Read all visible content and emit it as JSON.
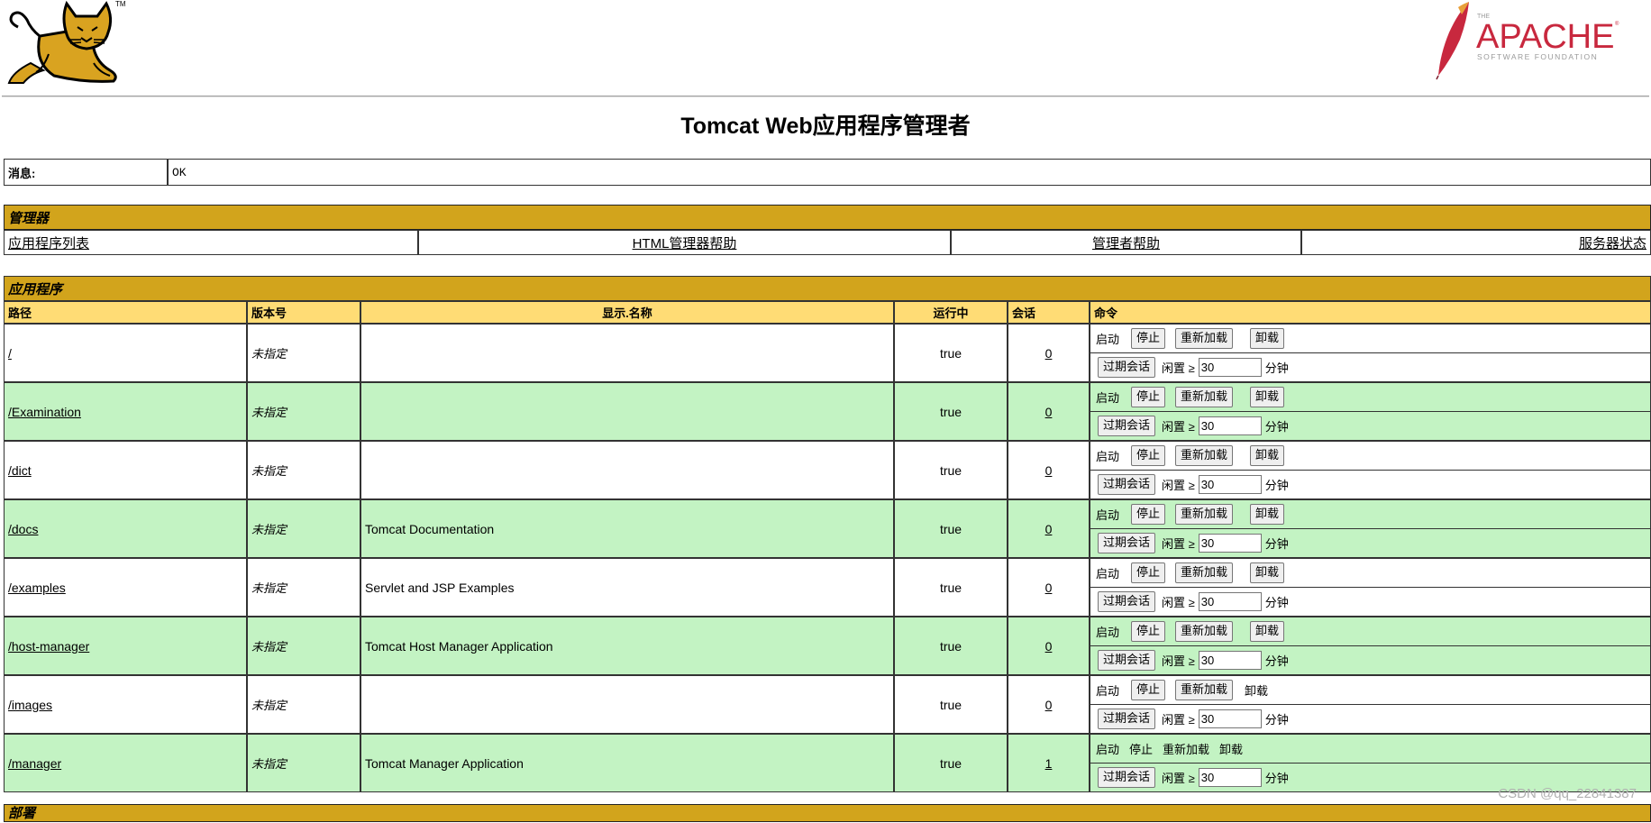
{
  "header": {
    "tomcat_tm": "TM",
    "apache_the": "THE",
    "apache_name": "APACHE",
    "apache_sub": "SOFTWARE FOUNDATION",
    "apache_reg": "®"
  },
  "page_title": "Tomcat Web应用程序管理者",
  "message": {
    "label": "消息:",
    "value": "OK"
  },
  "manager": {
    "title": "管理器",
    "links": [
      "应用程序列表",
      "HTML管理器帮助",
      "管理者帮助",
      "服务器状态"
    ]
  },
  "applications": {
    "title": "应用程序",
    "columns": [
      "路径",
      "版本号",
      "显示.名称",
      "运行中",
      "会话",
      "命令"
    ],
    "commands": {
      "start": "启动",
      "stop": "停止",
      "reload": "重新加载",
      "undeploy": "卸载",
      "expire": "过期会话",
      "idle": "闲置 ≥",
      "minutes": "分钟"
    },
    "rows": [
      {
        "path": "/",
        "version": "未指定",
        "display": "",
        "running": "true",
        "sessions": "0",
        "idle": "30"
      },
      {
        "path": "/Examination",
        "version": "未指定",
        "display": "",
        "running": "true",
        "sessions": "0",
        "idle": "30"
      },
      {
        "path": "/dict",
        "version": "未指定",
        "display": "",
        "running": "true",
        "sessions": "0",
        "idle": "30"
      },
      {
        "path": "/docs",
        "version": "未指定",
        "display": "Tomcat Documentation",
        "running": "true",
        "sessions": "0",
        "idle": "30"
      },
      {
        "path": "/examples",
        "version": "未指定",
        "display": "Servlet and JSP Examples",
        "running": "true",
        "sessions": "0",
        "idle": "30"
      },
      {
        "path": "/host-manager",
        "version": "未指定",
        "display": "Tomcat Host Manager Application",
        "running": "true",
        "sessions": "0",
        "idle": "30"
      },
      {
        "path": "/images",
        "version": "未指定",
        "display": "",
        "running": "true",
        "sessions": "0",
        "idle": "30"
      },
      {
        "path": "/manager",
        "version": "未指定",
        "display": "Tomcat Manager Application",
        "running": "true",
        "sessions": "1",
        "idle": "30"
      }
    ]
  },
  "deploy": {
    "title": "部署"
  },
  "watermark": "CSDN @qq_22841387",
  "colors": {
    "section_header": "#D2A41C",
    "column_header": "#FFDC75",
    "row_alt": "#C3F3C3",
    "apache_red": "#C8283E"
  },
  "icons": [
    "tomcat-logo-icon",
    "apache-feather-icon"
  ]
}
